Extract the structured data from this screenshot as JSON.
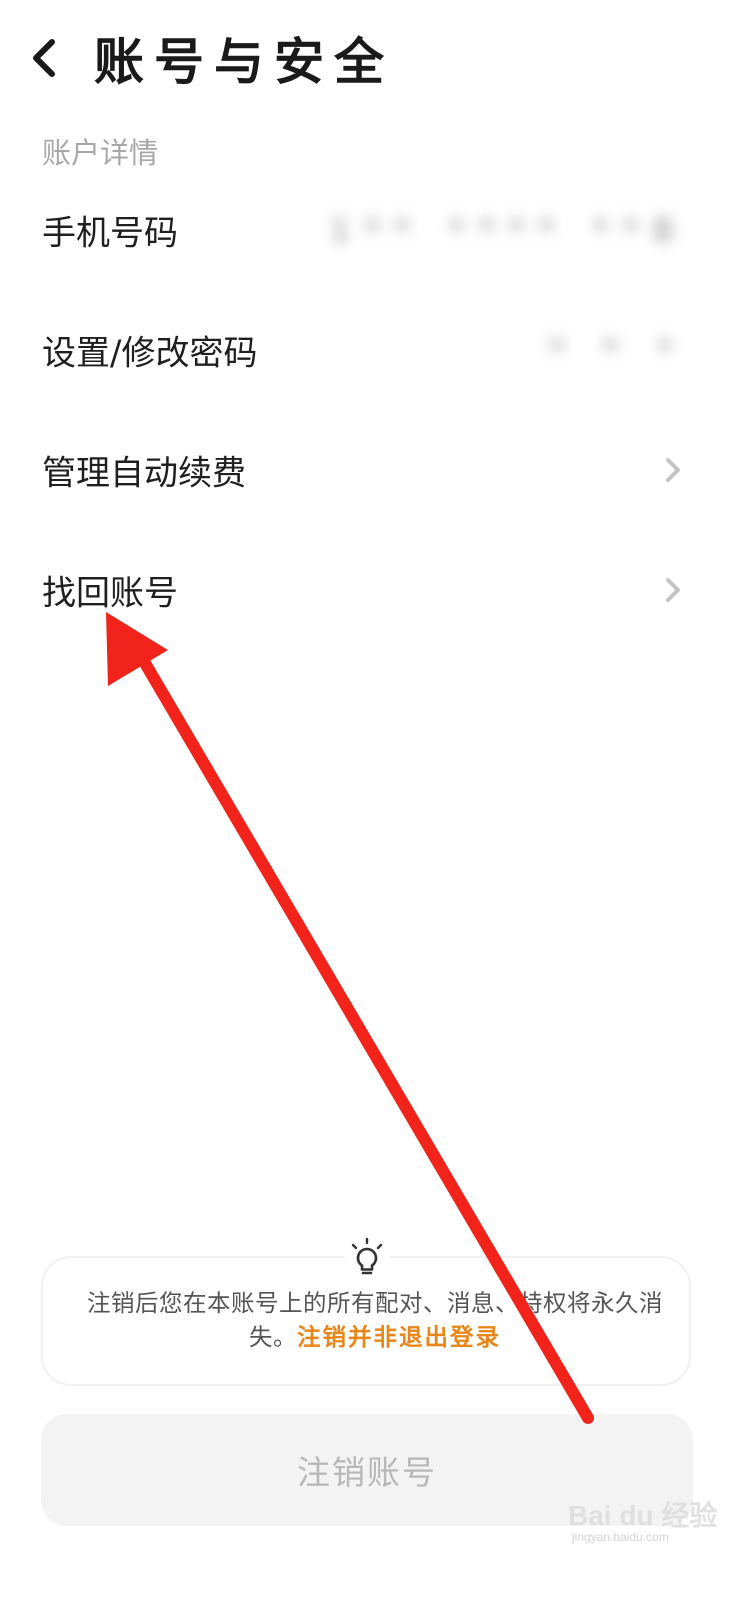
{
  "header": {
    "title": "账号与安全",
    "back_icon": "chevron-left-icon"
  },
  "section": {
    "label": "账户详情"
  },
  "rows": [
    {
      "label": "手机号码",
      "value": "1** **** **8",
      "value_obscured": true
    },
    {
      "label": "设置/修改密码",
      "value": "* * *",
      "value_obscured": true
    },
    {
      "label": "管理自动续费",
      "icon": "chevron-right-icon"
    },
    {
      "label": "找回账号",
      "icon": "chevron-right-icon"
    }
  ],
  "tip": {
    "icon": "lightbulb-icon",
    "text": "注销后您在本账号上的所有配对、消息、特权将永久消失。",
    "highlight": "注销并非退出登录",
    "highlight_color": "#e8861a"
  },
  "deactivate_button": {
    "label": "注销账号"
  },
  "annotation": {
    "type": "red-arrow",
    "color": "#f2231a"
  },
  "watermark": {
    "brand": "Bai du 经验",
    "url": "jingyan.baidu.com"
  }
}
